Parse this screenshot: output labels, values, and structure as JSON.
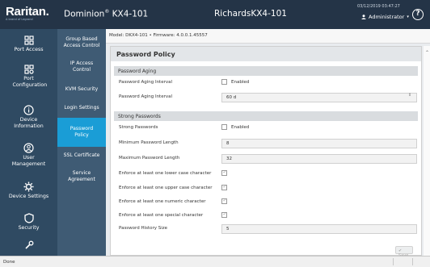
{
  "header": {
    "logo": "Raritan.",
    "logo_sub": "A brand of Legrand",
    "product_name": "Dominion",
    "product_sup": "®",
    "product_model": " KX4-101",
    "device_name": "RichardsKX4-101",
    "datetime": "03/12/2019 03:47:27",
    "user": "Administrator"
  },
  "leftnav": [
    {
      "label": "Port Access",
      "icon": "port-access-icon"
    },
    {
      "label": "Port Configuration",
      "icon": "port-configuration-icon"
    },
    {
      "label": "Device Information",
      "icon": "info-icon"
    },
    {
      "label": "User Management",
      "icon": "user-icon"
    },
    {
      "label": "Device Settings",
      "icon": "gear-icon"
    },
    {
      "label": "Security",
      "icon": "shield-icon"
    },
    {
      "label": "",
      "icon": "wrench-icon"
    }
  ],
  "submenu": [
    {
      "label": "Group Based Access Control"
    },
    {
      "label": "IP Access Control"
    },
    {
      "label": "KVM Security"
    },
    {
      "label": "Login Settings"
    },
    {
      "label": "Password Policy"
    },
    {
      "label": "SSL Certificate"
    },
    {
      "label": "Service Agreement"
    }
  ],
  "breadcrumb": "Model: DKX4-101  •  Firmware: 4.0.0.1.45557",
  "panel": {
    "title": "Password Policy",
    "aging": {
      "heading": "Password Aging",
      "interval_label": "Password Aging Interval",
      "enabled_label": "Enabled",
      "interval_label2": "Password Aging Interval",
      "interval_value": "60 d"
    },
    "strong": {
      "heading": "Strong Passwords",
      "strong_label": "Strong Passwords",
      "enabled_label": "Enabled",
      "min_label": "Minimum Password Length",
      "min_value": "8",
      "max_label": "Maximum Password Length",
      "max_value": "32",
      "lower_label": "Enforce at least one lower case character",
      "upper_label": "Enforce at least one upper case character",
      "numeric_label": "Enforce at least one numeric character",
      "special_label": "Enforce at least one special character",
      "history_label": "Password History Size",
      "history_value": "5"
    },
    "save_label": "✔ Save"
  },
  "status": "Done"
}
